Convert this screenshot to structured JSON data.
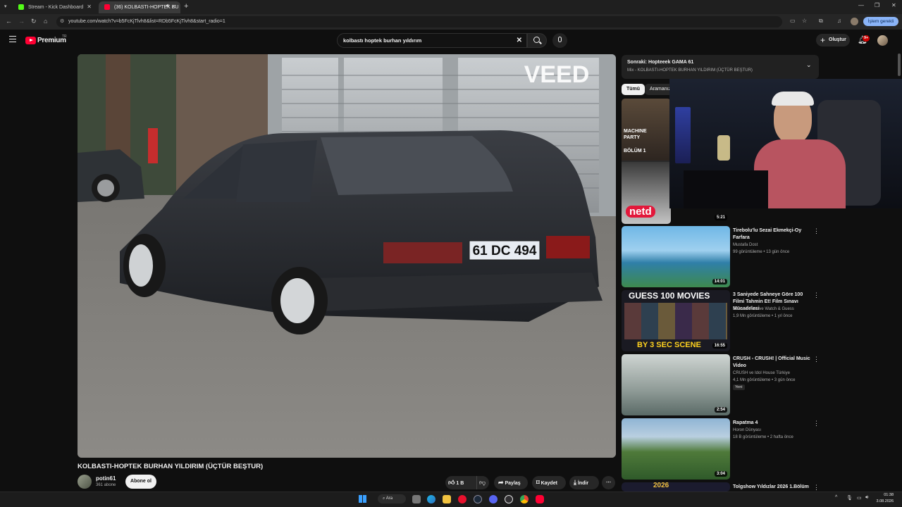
{
  "browser": {
    "tabs": [
      {
        "label": "Stream - Kick Dashboard",
        "color": "#53fc18"
      },
      {
        "label": "(36) KOLBASTI-HOPTEK BU",
        "color": "#ff0033"
      }
    ],
    "url": "youtube.com/watch?v=b5FcKjTlvh8&list=RDb5FcKjTlvh8&start_radio=1",
    "action_pill": "İşlem gerekli"
  },
  "youtube": {
    "logo": "Premium",
    "logo_sup": "TR",
    "search_value": "kolbastı hoptek burhan yıldırım",
    "create_label": "Oluştur",
    "notif_count": "9+"
  },
  "video": {
    "title": "KOLBASTI-HOPTEK BURHAN YILDIRIM (ÜÇTÜR BEŞTUR)",
    "watermark": "VEED",
    "plate": "61 DC 494",
    "channel": "potin61",
    "subs": "361 abone",
    "subscribe_label": "Abone ol",
    "likes": "1 B",
    "share_label": "Paylaş",
    "save_label": "Kaydet",
    "download_label": "İndir"
  },
  "upnext": {
    "title": "Sonraki: Hopteeek GAMA 61",
    "subtitle": "Mix - KOLBASTI-HOPTEK BURHAN YILDIRIM (ÜÇTÜR BEŞTUR)"
  },
  "chips": [
    "Tümü",
    "Aramanız"
  ],
  "recs": [
    {
      "title": "",
      "channel": "",
      "meta": "",
      "duration": "5:21",
      "badge": ""
    },
    {
      "title": "Tirebolu'lu Sezai Ekmekçi-Oy Farfara",
      "channel": "Mustafa Dost",
      "meta": "99 görüntüleme • 13 gün önce",
      "duration": "14:01",
      "badge": ""
    },
    {
      "title": "3 Saniyede Sahneye Göre 100 Filmi Tahmin Et! Film Sınavı Mücadelesi",
      "channel": "Guess It Fast ve Watch & Guess",
      "meta": "1,9 Mn görüntüleme • 1 yıl önce",
      "duration": "16:55",
      "badge": ""
    },
    {
      "title": "CRUSH - CRUSH! | Official Music Video",
      "channel": "CRUSH ve Idol House Türkiye",
      "meta": "4,1 Mn görüntüleme • 3 gün önce",
      "duration": "2:54",
      "badge": "Yeni"
    },
    {
      "title": "Rapatma 4",
      "channel": "Horon Dünyası",
      "meta": "18 B görüntüleme • 2 hafta önce",
      "duration": "3:04",
      "badge": ""
    },
    {
      "title": "Tolgshow Yıldızlar 2026 1.Bölüm",
      "channel": "",
      "meta": "",
      "duration": "",
      "badge": ""
    }
  ],
  "thumb_text": {
    "machine": "MACHINE PARTY",
    "bolum": "BÖLÜM 1",
    "netd": "netd",
    "guess_top": "GUESS 100 MOVIES",
    "guess_bottom": "BY 3 SEC SCENE",
    "year": "2026"
  },
  "taskbar": {
    "search_label": "Ara",
    "time": "01:38",
    "date": "3.08.2026"
  }
}
